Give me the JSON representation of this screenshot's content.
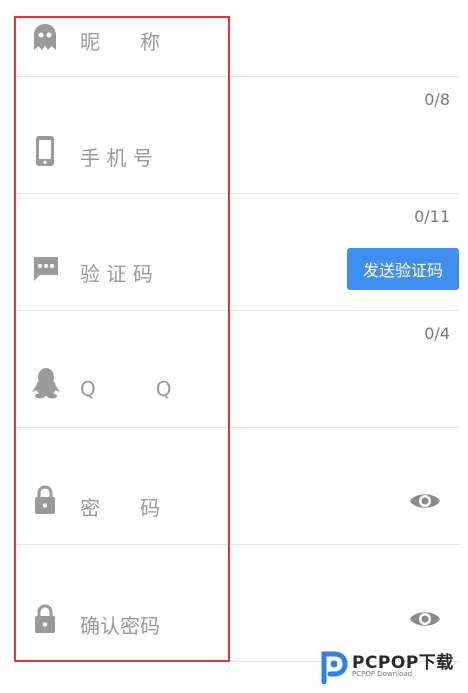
{
  "fields": {
    "nickname": {
      "label": "昵　　称",
      "icon": "ghost-icon"
    },
    "phone": {
      "label": "手 机 号",
      "icon": "phone-icon",
      "counter": "0/8"
    },
    "verify_code": {
      "label": "验 证 码",
      "icon": "message-icon",
      "counter": "0/11",
      "send_button_label": "发送验证码"
    },
    "qq": {
      "label": "Q　　　Q",
      "icon": "penguin-icon",
      "counter": "0/4"
    },
    "password": {
      "label": "密　　码",
      "icon": "lock-icon",
      "toggle_icon": "eye-icon"
    },
    "confirm_password": {
      "label": "确认密码",
      "icon": "lock-icon",
      "toggle_icon": "eye-icon"
    }
  },
  "watermark": {
    "brand": "PCPOP下载",
    "sub": "PCPOP Download"
  },
  "colors": {
    "accent": "#3f8ff0",
    "highlight": "#e53333",
    "icon": "#9a9a9a"
  }
}
